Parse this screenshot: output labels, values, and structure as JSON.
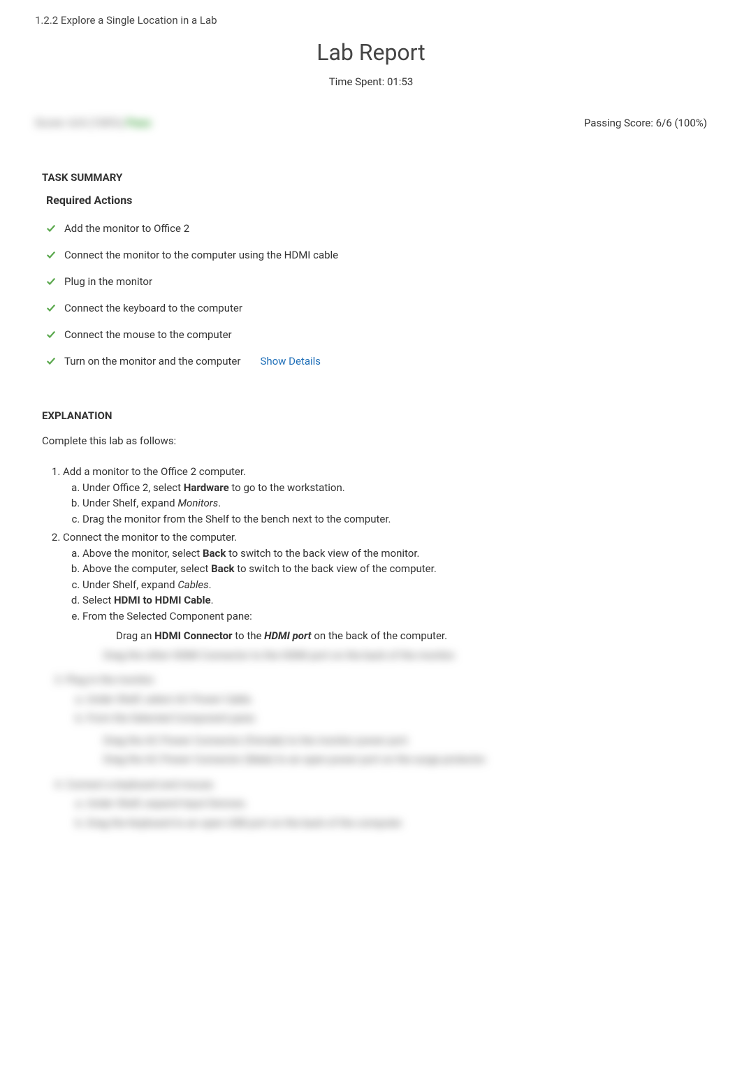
{
  "breadcrumb": "1.2.2 Explore a Single Location in a Lab",
  "report_title": "Lab Report",
  "time_spent_label": "Time Spent: 01:53",
  "score_blurred": "Score: 6/6 (100%) ",
  "score_pass": "Pass",
  "passing_score": "Passing Score: 6/6 (100%)",
  "task_summary_heading": "TASK SUMMARY",
  "required_actions_heading": "Required Actions",
  "actions": [
    {
      "label": "Add the monitor to Office 2",
      "details": false
    },
    {
      "label": "Connect the monitor to the computer using the HDMI cable",
      "details": false
    },
    {
      "label": "Plug in the monitor",
      "details": false
    },
    {
      "label": "Connect the keyboard to the computer",
      "details": false
    },
    {
      "label": "Connect the mouse to the computer",
      "details": false
    },
    {
      "label": "Turn on the monitor and the computer",
      "details": true
    }
  ],
  "show_details_label": "Show Details",
  "explanation_heading": "EXPLANATION",
  "explanation_intro": "Complete this lab as follows:",
  "steps": {
    "s1": {
      "title": "Add a monitor to the Office 2 computer.",
      "a_pre": "Under Office 2, select ",
      "a_bold": "Hardware",
      "a_post": " to go to the workstation.",
      "b_pre": "Under Shelf, expand ",
      "b_em": "Monitors",
      "b_post": ".",
      "c": "Drag the monitor from the Shelf to the bench next to the computer."
    },
    "s2": {
      "title": "Connect the monitor to the computer.",
      "a_pre": "Above the monitor, select ",
      "a_bold": "Back",
      "a_post": " to switch to the back view of the monitor.",
      "b_pre": "Above the computer, select ",
      "b_bold": "Back",
      "b_post": " to switch to the back view of the computer.",
      "c_pre": "Under Shelf, expand ",
      "c_em": "Cables",
      "c_post": ".",
      "d_pre": "Select ",
      "d_bold": "HDMI to HDMI Cable",
      "d_post": ".",
      "e": "From the Selected Component pane:",
      "e_sub_pre": "Drag an ",
      "e_sub_bold": "HDMI Connector",
      "e_sub_mid": " to the ",
      "e_sub_em": "HDMI port",
      "e_sub_post": " on the back of the computer."
    }
  },
  "blurred_lines": [
    "Drag the other HDMI Connector to the HDMI port on the back of the monitor.",
    "3. Plug in the monitor.",
    "a. Under Shelf, select AC Power Cable.",
    "b. From the Selected Component pane:",
    "Drag the AC Power Connector (Female) to the monitor power port.",
    "Drag the AC Power Connector (Male) to an open power port on the surge protector.",
    "4. Connect a keyboard and mouse.",
    "a. Under Shelf, expand Input Devices.",
    "b. Drag the Keyboard to an open USB port on the back of the computer."
  ]
}
